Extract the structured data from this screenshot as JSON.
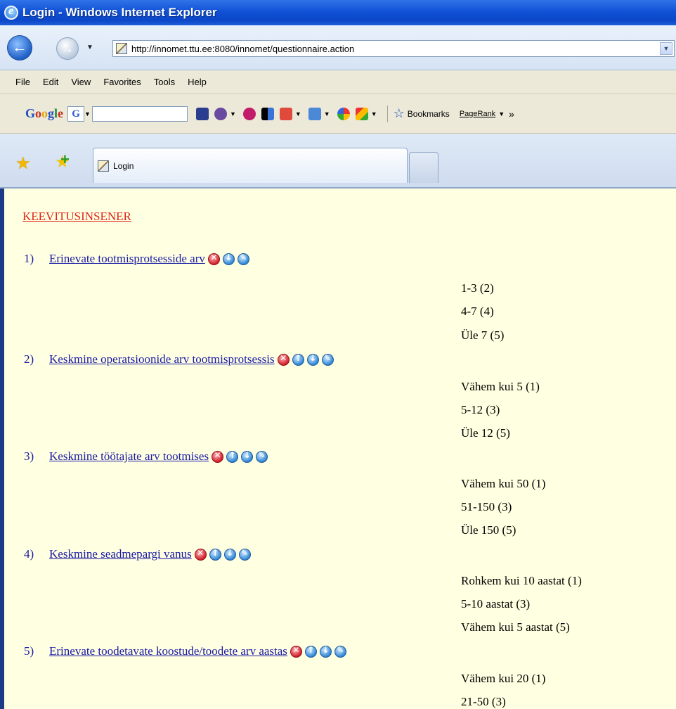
{
  "window": {
    "title": "Login - Windows Internet Explorer"
  },
  "address_bar": {
    "url": "http://innomet.ttu.ee:8080/innomet/questionnaire.action"
  },
  "menu": [
    "File",
    "Edit",
    "View",
    "Favorites",
    "Tools",
    "Help"
  ],
  "google_toolbar": {
    "logo": "Google",
    "g_button": "G",
    "bookmarks_label": "Bookmarks",
    "pagerank_label": "PageRank",
    "overflow": "»"
  },
  "tab": {
    "label": "Login"
  },
  "page": {
    "heading": "KEEVITUSINSENER",
    "questions": [
      {
        "number": "1)",
        "text": "Erinevate tootmisprotsesside arv",
        "options": [
          "1-3 (2)",
          "4-7 (4)",
          "Üle 7 (5)"
        ]
      },
      {
        "number": "2)",
        "text": "Keskmine operatsioonide arv tootmisprotsessis",
        "options": [
          "Vähem kui 5 (1)",
          "5-12 (3)",
          "Üle 12 (5)"
        ]
      },
      {
        "number": "3)",
        "text": "Keskmine töötajate arv tootmises",
        "options": [
          "Vähem kui 50 (1)",
          "51-150 (3)",
          "Üle 150 (5)"
        ]
      },
      {
        "number": "4)",
        "text": "Keskmine seadmepargi vanus",
        "options": [
          "Rohkem kui 10 aastat (1)",
          "5-10 aastat (3)",
          "Vähem kui 5 aastat (5)"
        ]
      },
      {
        "number": "5)",
        "text": "Erinevate toodetavate koostude/toodete arv aastas",
        "options": [
          "Vähem kui 20 (1)",
          "21-50 (3)"
        ]
      }
    ]
  },
  "colors": {
    "title_bar": "#0b47c8",
    "page_background": "#ffffe1",
    "heading": "#e0241a",
    "link": "#1a1aa6"
  },
  "icons": [
    "ie-logo-icon",
    "back-arrow-icon",
    "forward-arrow-icon",
    "page-icon",
    "favorites-star-icon",
    "add-favorites-icon",
    "delete-icon",
    "move-up-icon",
    "move-down-icon",
    "edit-icon"
  ]
}
